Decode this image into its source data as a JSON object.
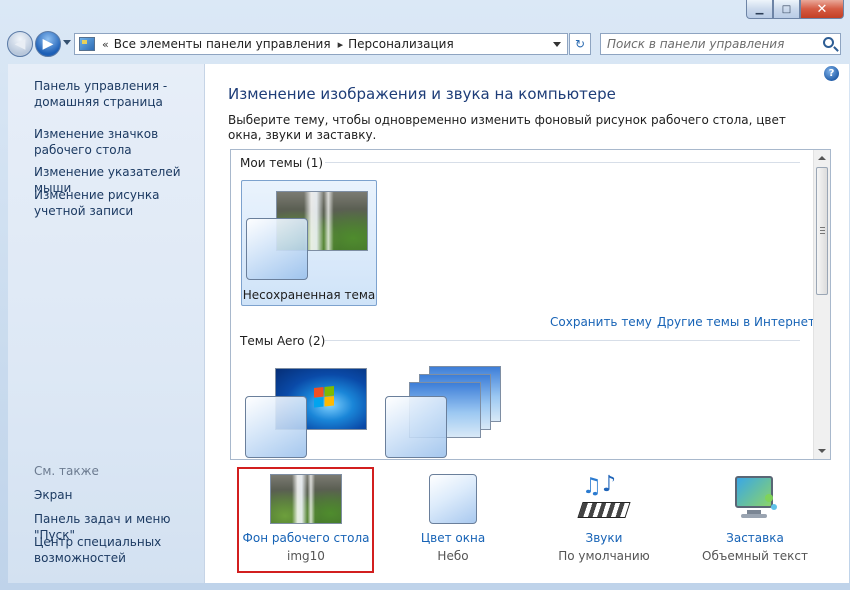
{
  "window": {
    "minimize": "▁",
    "maximize": "□",
    "close": "✕"
  },
  "nav": {
    "crumb_prefix": "«",
    "crumbs": [
      "Все элементы панели управления",
      "Персонализация"
    ],
    "crumb_arrow": "▸",
    "search_placeholder": "Поиск в панели управления"
  },
  "sidebar": {
    "items": [
      {
        "label": "Панель управления - домашняя страница"
      },
      {
        "label": "Изменение значков рабочего стола"
      },
      {
        "label": "Изменение указателей мыши"
      },
      {
        "label": "Изменение рисунка учетной записи"
      }
    ],
    "see_also_title": "См. также",
    "see_also": [
      {
        "label": "Экран"
      },
      {
        "label": "Панель задач и меню \"Пуск\""
      },
      {
        "label": "Центр специальных возможностей"
      }
    ]
  },
  "main": {
    "help": "?",
    "title": "Изменение изображения и звука на компьютере",
    "description": "Выберите тему, чтобы одновременно изменить фоновый рисунок рабочего стола, цвет окна, звуки и заставку.",
    "my_themes_label": "Мои темы (1)",
    "unsaved_theme": "Несохраненная тема",
    "save_theme_link": "Сохранить тему",
    "more_themes_link": "Другие темы в Интернете",
    "aero_themes_label": "Темы Aero (2)"
  },
  "bottom": [
    {
      "label": "Фон рабочего стола",
      "value": "img10",
      "icon": "desktop-background-icon"
    },
    {
      "label": "Цвет окна",
      "value": "Небо",
      "icon": "window-color-icon"
    },
    {
      "label": "Звуки",
      "value": "По умолчанию",
      "icon": "sounds-icon"
    },
    {
      "label": "Заставка",
      "value": "Объемный текст",
      "icon": "screensaver-icon"
    }
  ],
  "colors": {
    "highlight_border": "#d21f1f",
    "link": "#1763b6",
    "title": "#1e3d78"
  }
}
